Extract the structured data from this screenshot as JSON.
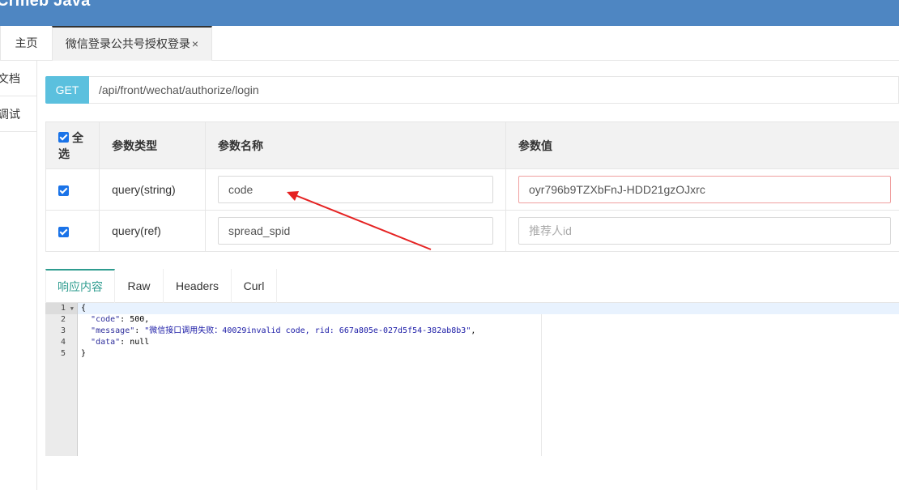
{
  "header": {
    "brand": "Crmeb Java"
  },
  "tabs": {
    "home": "主页",
    "active": "微信登录公共号授权登录",
    "close": "×"
  },
  "sidebar": {
    "items": [
      {
        "label": "文档"
      },
      {
        "label": "调试"
      }
    ]
  },
  "request": {
    "method": "GET",
    "url": "/api/front/wechat/authorize/login"
  },
  "params": {
    "headers": {
      "select_all": "全选",
      "type": "参数类型",
      "name": "参数名称",
      "value": "参数值"
    },
    "rows": [
      {
        "checked": true,
        "type": "query(string)",
        "name": "code",
        "value": "oyr796b9TZXbFnJ-HDD21gzOJxrc",
        "placeholder": ""
      },
      {
        "checked": true,
        "type": "query(ref)",
        "name": "spread_spid",
        "value": "",
        "placeholder": "推荐人id"
      }
    ]
  },
  "response": {
    "tabs": [
      "响应内容",
      "Raw",
      "Headers",
      "Curl"
    ],
    "line_numbers": [
      "1",
      "2",
      "3",
      "4",
      "5"
    ],
    "lines": {
      "l1": "{",
      "l2_key": "\"code\"",
      "l2_val": "500",
      "l3_key": "\"message\"",
      "l3_val": "\"微信接口调用失败：40029invalid code, rid: 667a805e-027d5f54-382ab8b3\"",
      "l4_key": "\"data\"",
      "l4_val": "null",
      "l5": "}"
    }
  },
  "colors": {
    "header": "#4e86c2",
    "method": "#5bc0de",
    "active_tab": "#2e9c8f",
    "arrow": "#e52222"
  }
}
